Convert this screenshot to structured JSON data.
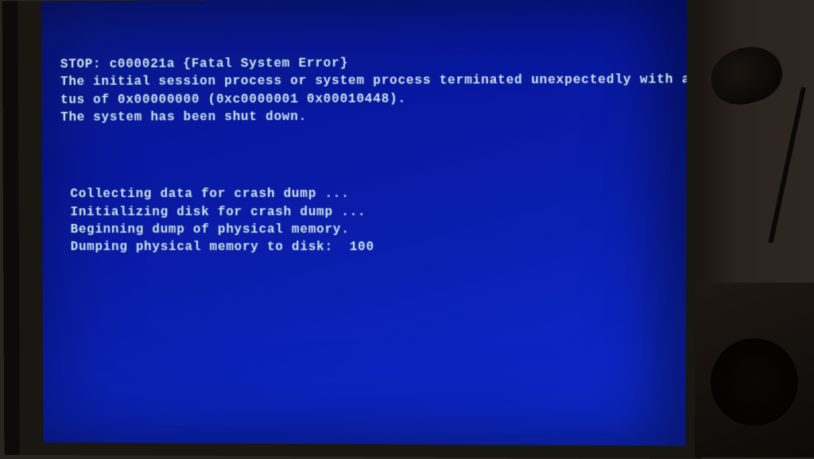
{
  "bsod": {
    "error_header": "STOP: c000021a {Fatal System Error}",
    "line_1": "The initial session process or system process terminated unexpectedly with a sta",
    "line_2": "tus of 0x00000000 (0xc0000001 0x00010448).",
    "line_3": "The system has been shut down.",
    "dump": {
      "collecting": "Collecting data for crash dump ...",
      "init": "Initializing disk for crash dump ...",
      "beginning": "Beginning dump of physical memory.",
      "dumping": "Dumping physical memory to disk:  100"
    }
  }
}
